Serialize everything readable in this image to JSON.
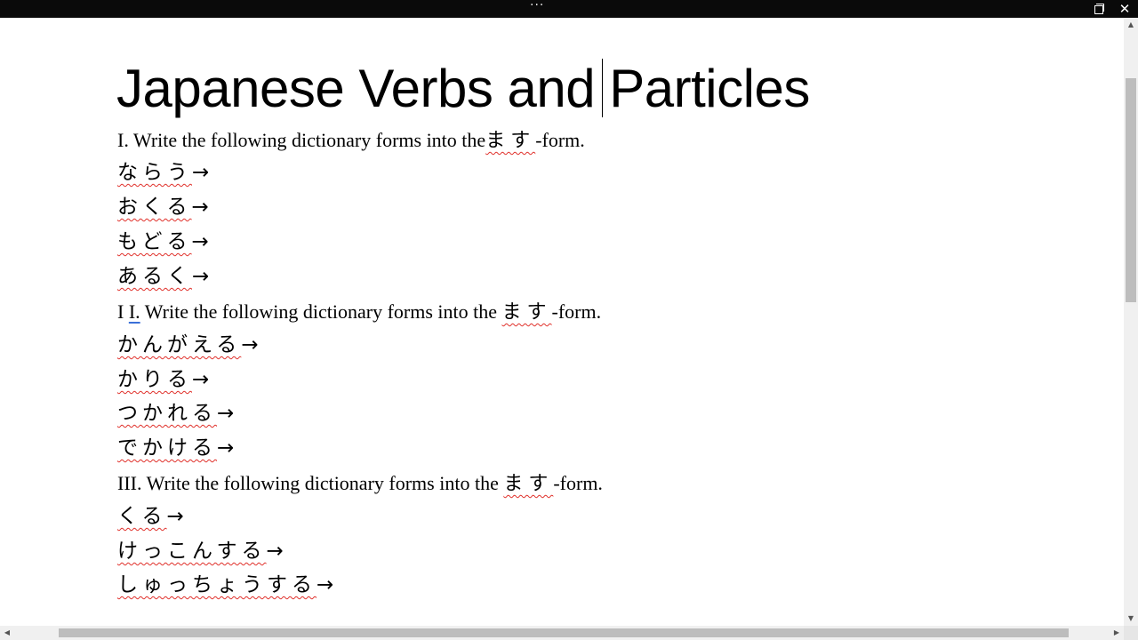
{
  "window": {
    "more_label": "···",
    "restore_label": "restore",
    "close_label": "✕"
  },
  "document": {
    "title": "Japanese Verbs and Particles",
    "sections": [
      {
        "instruction_prefix": "I. Write the following dictionary forms into the",
        "instruction_highlight": "ます",
        "instruction_suffix": "-form.",
        "items": [
          "ならう",
          "おくる",
          "もどる",
          "あるく"
        ]
      },
      {
        "instruction_prefix_a": "I",
        "instruction_prefix_b": "I.",
        "instruction_prefix_c": "Write the following dictionary forms into the",
        "instruction_highlight": "ます",
        "instruction_suffix": "-form.",
        "items": [
          "かんがえる",
          "かりる",
          "つかれる",
          "でかける"
        ]
      },
      {
        "instruction_prefix": "III. Write the following dictionary forms into the",
        "instruction_highlight": "ます",
        "instruction_suffix": "-form.",
        "items": [
          "くる",
          "けっこんする",
          "しゅっちょうする"
        ]
      }
    ],
    "arrow": "→"
  },
  "scrollbars": {
    "up_arrow": "▲",
    "down_arrow": "▼",
    "left_arrow": "◀",
    "right_arrow": "▶"
  }
}
